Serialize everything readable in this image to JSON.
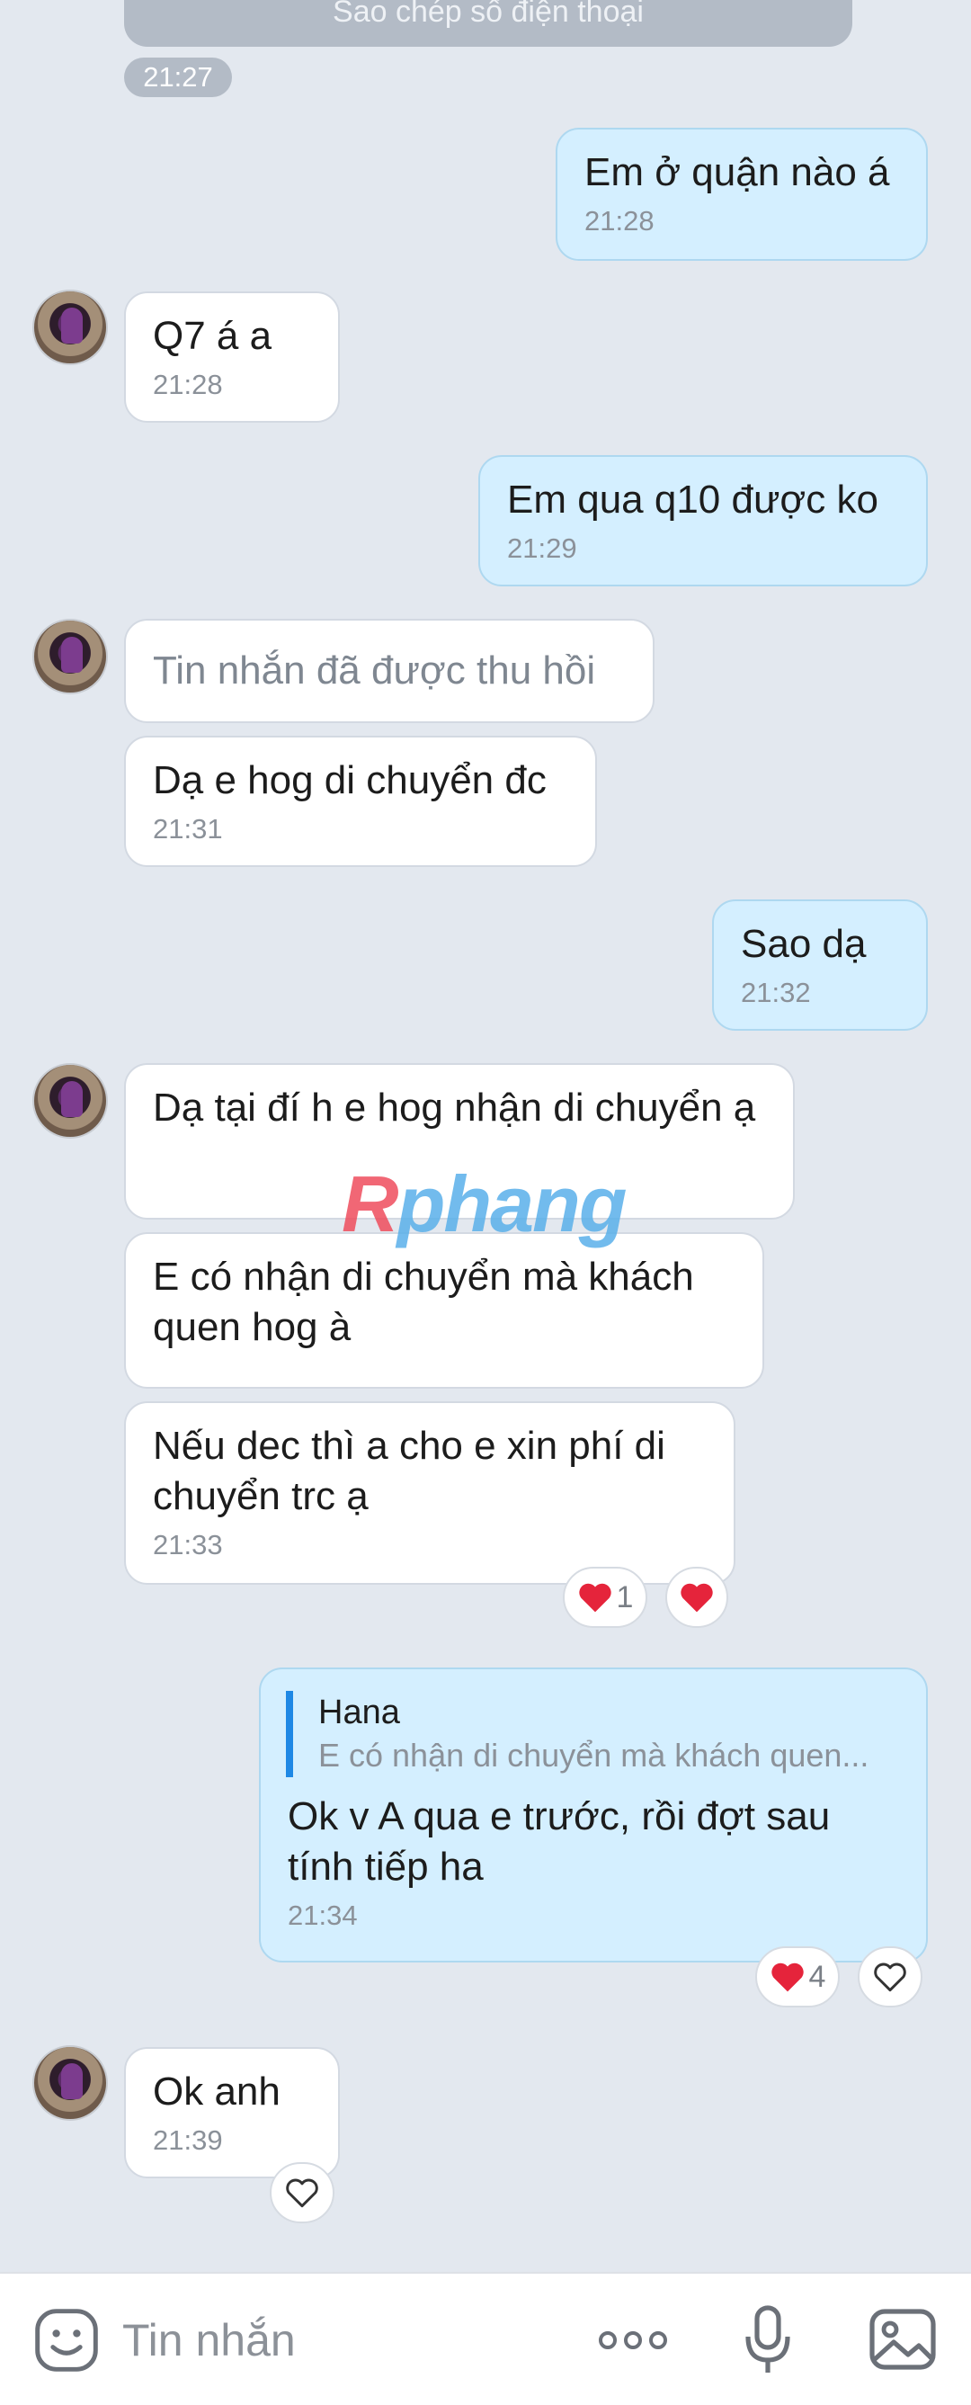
{
  "top": {
    "copy_phone_label": "Sao chép số điện thoại",
    "time_divider": "21:27"
  },
  "messages": [
    {
      "side": "out",
      "text": "Em ở quận nào á",
      "time": "21:28"
    },
    {
      "side": "in",
      "text": "Q7 á a",
      "time": "21:28"
    },
    {
      "side": "out",
      "text": "Em qua q10 được ko",
      "time": "21:29"
    },
    {
      "side": "in",
      "text": "Tin nhắn đã được thu hồi",
      "recalled": true
    },
    {
      "side": "in",
      "text": "Dạ e hog di chuyển đc",
      "time": "21:31"
    },
    {
      "side": "out",
      "text": "Sao dạ",
      "time": "21:32"
    },
    {
      "side": "in",
      "text": "Dạ tại đí h e hog nhận di chuyển ạ"
    },
    {
      "side": "in",
      "text": "E có nhận di chuyển mà khách quen hog à"
    },
    {
      "side": "in",
      "text": "Nếu dec thì a cho e xin phí di chuyển trc ạ",
      "time": "21:33",
      "reaction_count": "1"
    },
    {
      "side": "out",
      "reply_name": "Hana",
      "reply_text": "E có nhận di chuyển mà khách quen...",
      "text": "Ok v A qua e trước, rồi đợt sau tính tiếp ha",
      "time": "21:34",
      "reaction_count": "4"
    },
    {
      "side": "in",
      "text": "Ok anh",
      "time": "21:39"
    }
  ],
  "watermark": {
    "first": "R",
    "rest": "phang"
  },
  "composer": {
    "placeholder": "Tin nhắn"
  },
  "icons": [
    "emoji-icon",
    "more-icon",
    "microphone-icon",
    "image-icon",
    "heart-icon"
  ],
  "colors": {
    "background": "#e3e8ef",
    "outgoing_bubble": "#d4efff",
    "incoming_bubble": "#ffffff",
    "reply_bar": "#1e88e5",
    "heart": "#e5243b"
  }
}
